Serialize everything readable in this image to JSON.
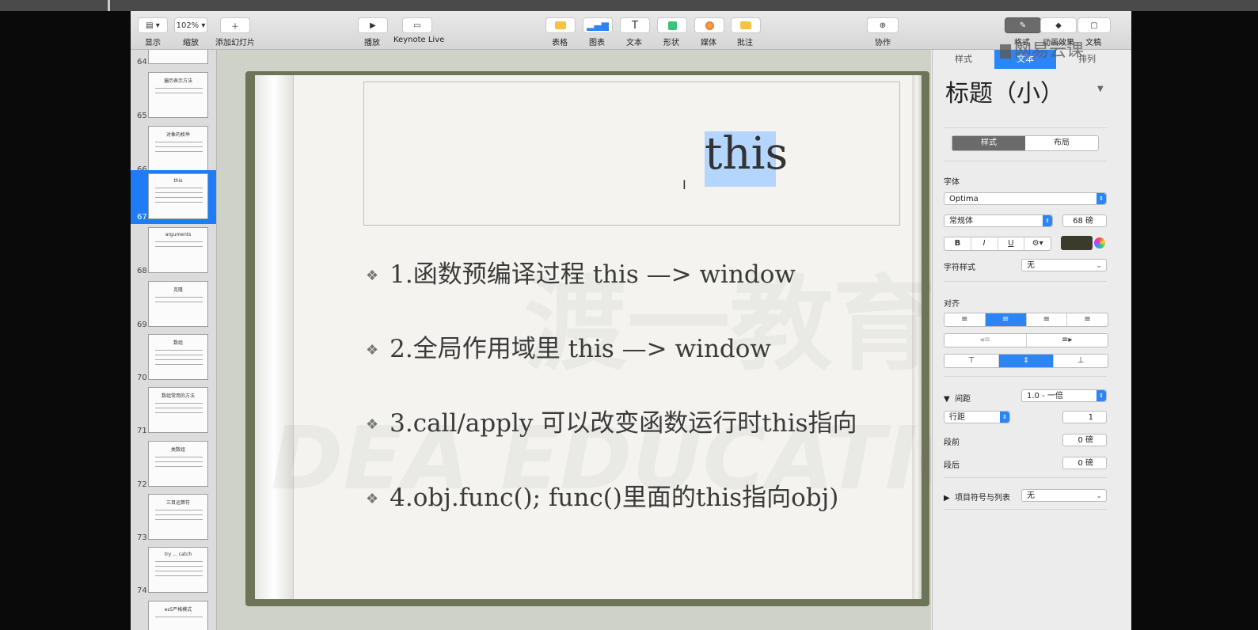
{
  "toolbar": {
    "view": {
      "label": "显示"
    },
    "zoom": {
      "value": "102%",
      "label": "缩放"
    },
    "add_slide": {
      "label": "添加幻灯片"
    },
    "play": {
      "label": "播放"
    },
    "keynote_live": {
      "label": "Keynote Live"
    },
    "table": {
      "label": "表格"
    },
    "chart": {
      "label": "图表"
    },
    "text": {
      "label": "文本"
    },
    "shape": {
      "label": "形状"
    },
    "media": {
      "label": "媒体"
    },
    "comment": {
      "label": "批注"
    },
    "collaborate": {
      "label": "协作"
    },
    "format": {
      "label": "格式"
    },
    "animate": {
      "label": "动画效果"
    },
    "document": {
      "label": "文稿"
    }
  },
  "watermark_logo": "网易云课",
  "thumbnails": [
    {
      "num": "64",
      "title": ""
    },
    {
      "num": "65",
      "title": "遍历表示方法"
    },
    {
      "num": "66",
      "title": "对象的枚举"
    },
    {
      "num": "67",
      "title": "this",
      "selected": true
    },
    {
      "num": "68",
      "title": "arguments"
    },
    {
      "num": "69",
      "title": "克隆"
    },
    {
      "num": "70",
      "title": "数组"
    },
    {
      "num": "71",
      "title": "数组常用的方法"
    },
    {
      "num": "72",
      "title": "类数组"
    },
    {
      "num": "73",
      "title": "三目运算符"
    },
    {
      "num": "74",
      "title": "try ... catch"
    },
    {
      "num": "",
      "title": "es5严格模式"
    }
  ],
  "slide": {
    "title": "this",
    "bullets": [
      "1.函数预编译过程 this —> window",
      "2.全局作用域里 this —> window",
      "3.call/apply 可以改变函数运行时this指向",
      "4.obj.func();   func()里面的this指向obj)"
    ],
    "watermark_text": "渡一教育",
    "watermark_text2": "DEA EDUCATION"
  },
  "inspector": {
    "tabs": [
      "样式",
      "文本",
      "排列"
    ],
    "active_tab": "文本",
    "paragraph_style": "标题（小）",
    "sub_tabs": [
      "样式",
      "布局"
    ],
    "font_label": "字体",
    "font_name": "Optima",
    "font_style": "常规体",
    "font_size": "68 磅",
    "bold": "B",
    "italic": "I",
    "underline": "U",
    "char_style_label": "字符样式",
    "char_style_value": "无",
    "align_label": "对齐",
    "spacing_label": "间距",
    "spacing_value": "1.0 - 一倍",
    "line_spacing_label": "行距",
    "line_spacing_value": "1",
    "before_label": "段前",
    "before_value": "0 磅",
    "after_label": "段后",
    "after_value": "0 磅",
    "bullets_label": "项目符号与列表",
    "bullets_value": "无",
    "text_color": "#3b3b2c"
  }
}
